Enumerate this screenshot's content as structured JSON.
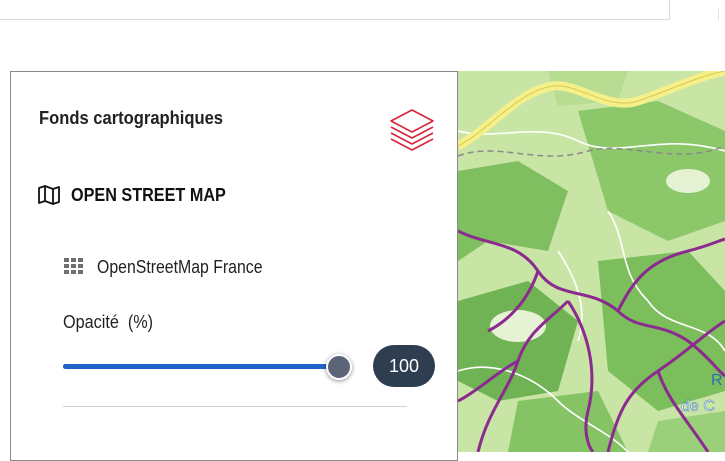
{
  "panel": {
    "title": "Fonds cartographiques",
    "layers_icon": "layers-stack-icon",
    "group": {
      "icon": "map-folded-icon",
      "label": "OPEN STREET MAP"
    },
    "layer": {
      "icon": "grid-icon",
      "label": "OpenStreetMap France"
    },
    "opacity": {
      "label": "Opacité  (%)",
      "value": 100,
      "display": "100"
    }
  },
  "map": {
    "visible_text": [
      "R",
      "de C"
    ]
  },
  "colors": {
    "accent_red": "#d7263d",
    "slider_blue": "#1f63c9",
    "badge_bg": "#2e3d4f",
    "map_green": "#7fbf5f",
    "map_light_green": "#c9e5a6",
    "route_purple": "#8b2a8f",
    "highway_yellow": "#f6f08a"
  }
}
